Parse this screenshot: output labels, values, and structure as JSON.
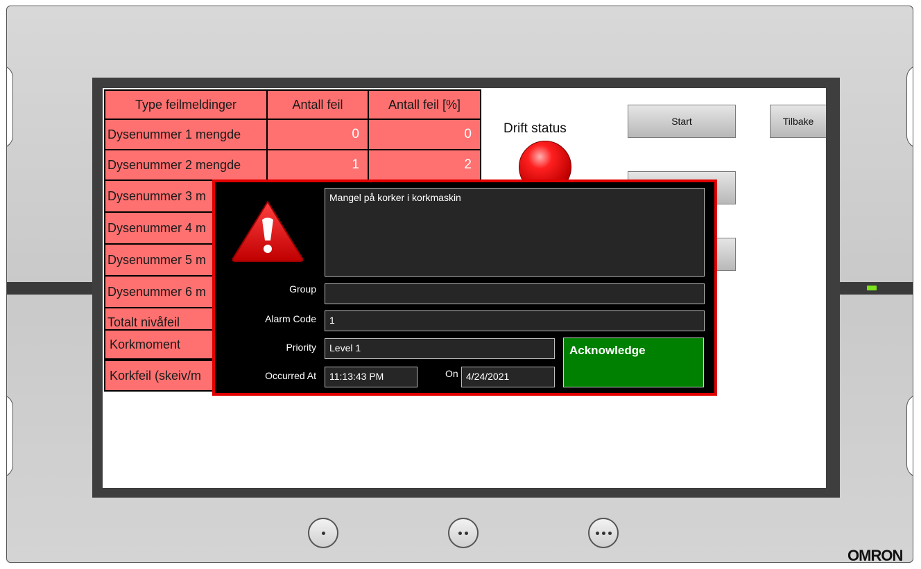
{
  "table": {
    "headers": [
      "Type feilmeldinger",
      "Antall feil",
      "Antall feil [%]"
    ],
    "rows": [
      {
        "label": "Dysenummer 1 mengde",
        "count": "0",
        "percent": "0"
      },
      {
        "label": "Dysenummer 2 mengde",
        "count": "1",
        "percent": "2"
      },
      {
        "label": "Dysenummer 3 m",
        "count": "",
        "percent": ""
      },
      {
        "label": "Dysenummer 4 m",
        "count": "",
        "percent": ""
      },
      {
        "label": "Dysenummer 5 m",
        "count": "",
        "percent": ""
      },
      {
        "label": "Dysenummer 6 m",
        "count": "",
        "percent": ""
      },
      {
        "label": "Totalt nivåfeil",
        "count": "",
        "percent": ""
      },
      {
        "label": "Korkmoment",
        "count": "",
        "percent": ""
      },
      {
        "label": "Korkfeil (skeiv/m",
        "count": "",
        "percent": ""
      }
    ]
  },
  "status": {
    "drift_label": "Drift status",
    "led_color": "#e00000"
  },
  "buttons": {
    "start": "Start",
    "back": "Tilbake"
  },
  "alarm": {
    "message": "Mangel på korker i korkmaskin",
    "group_label": "Group",
    "group_value": "",
    "alarm_code_label": "Alarm Code",
    "alarm_code_value": "1",
    "priority_label": "Priority",
    "priority_value": "Level 1",
    "occurred_label": "Occurred At",
    "occurred_time": "11:13:43 PM",
    "on_label": "On",
    "occurred_date": "4/24/2021",
    "acknowledge_label": "Acknowledge",
    "icon": "warning-triangle-icon",
    "border_color": "#e00000"
  },
  "device": {
    "brand": "OMRON",
    "status_led_color": "#7be31c",
    "function_keys": [
      "one-dot-key",
      "two-dot-key",
      "three-dot-key"
    ]
  }
}
